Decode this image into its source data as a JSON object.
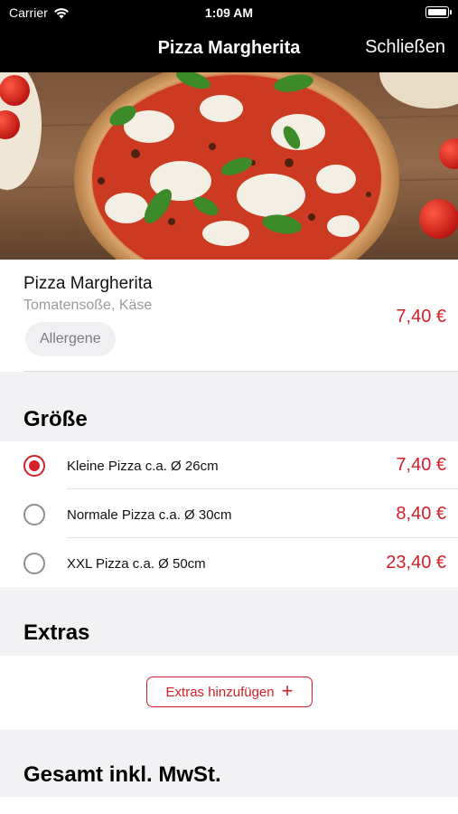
{
  "status": {
    "carrier": "Carrier",
    "time": "1:09 AM"
  },
  "nav": {
    "title": "Pizza Margherita",
    "close_label": "Schließen"
  },
  "product": {
    "name": "Pizza Margherita",
    "description": "Tomatensoße, Käse",
    "allergene_label": "Allergene",
    "price": "7,40 €"
  },
  "size_section": {
    "title": "Größe",
    "options": [
      {
        "label": "Kleine Pizza c.a. Ø 26cm",
        "price": "7,40 €",
        "selected": true
      },
      {
        "label": "Normale Pizza c.a. Ø 30cm",
        "price": "8,40 €",
        "selected": false
      },
      {
        "label": "XXL Pizza c.a. Ø 50cm",
        "price": "23,40 €",
        "selected": false
      }
    ]
  },
  "extras_section": {
    "title": "Extras",
    "add_button_label": "Extras hinzufügen"
  },
  "total_section": {
    "title": "Gesamt inkl. MwSt."
  },
  "colors": {
    "accent": "#d3202a",
    "bar": "#000000"
  }
}
